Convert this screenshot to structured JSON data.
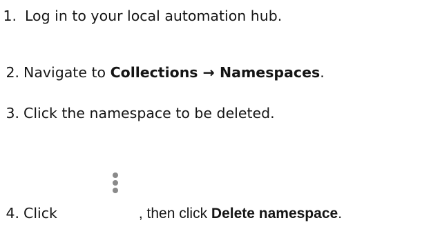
{
  "steps": [
    {
      "number": "1.",
      "text": "Log in to your local automation hub."
    },
    {
      "number": "2.",
      "prefix": "Navigate to ",
      "bold": "Collections → Namespaces",
      "suffix": "."
    },
    {
      "number": "3.",
      "text": "Click the namespace to be deleted."
    },
    {
      "number": "4.",
      "prefix": "Click",
      "icon": "kebab-menu-icon",
      "middle": ", then click ",
      "bold": "Delete namespace",
      "suffix": "."
    }
  ],
  "colors": {
    "text": "#151515",
    "icon": "#8a8a8a"
  }
}
